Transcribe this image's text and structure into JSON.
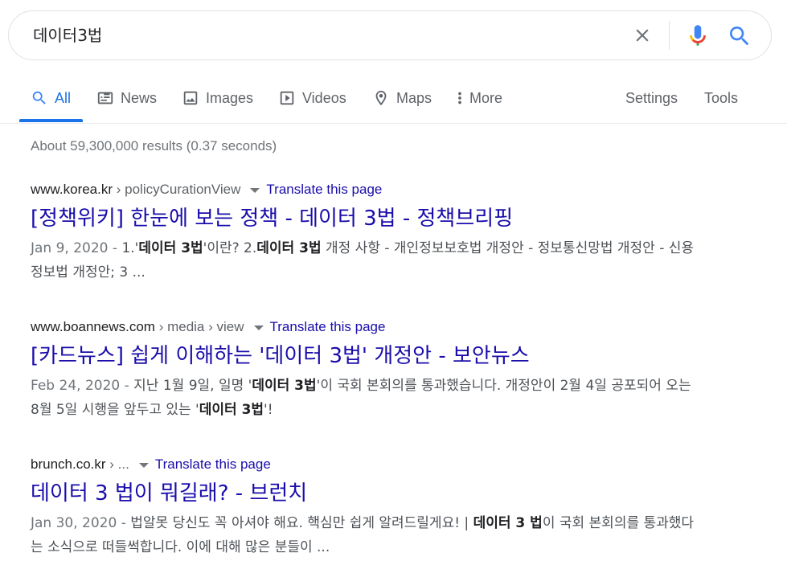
{
  "search": {
    "query": "데이터3법"
  },
  "tabs": [
    {
      "label": "All",
      "icon": "search-icon"
    },
    {
      "label": "News",
      "icon": "news-icon"
    },
    {
      "label": "Images",
      "icon": "image-icon"
    },
    {
      "label": "Videos",
      "icon": "play-icon"
    },
    {
      "label": "Maps",
      "icon": "map-pin-icon"
    },
    {
      "label": "More",
      "icon": "more-vert-icon"
    }
  ],
  "tools": {
    "settings": "Settings",
    "tools": "Tools"
  },
  "stats": "About 59,300,000 results (0.37 seconds)",
  "colors": {
    "link": "#1a0dab",
    "accent": "#1a73e8",
    "snippet": "#4d5156"
  },
  "results": [
    {
      "domain": "www.korea.kr",
      "path": " › policyCurationView",
      "translate": "Translate this page",
      "title": "[정책위키] 한눈에 보는 정책 - 데이터 3법 - 정책브리핑",
      "date": "Jan 9, 2020 - ",
      "snippet_parts": [
        "1.'",
        "데이터 3법",
        "'이란? 2.",
        "데이터 3법",
        " 개정 사항 - 개인정보보호법 개정안 - 정보통신망법 개정안 - 신용정보법 개정안; 3 ..."
      ]
    },
    {
      "domain": "www.boannews.com",
      "path": " › media › view",
      "translate": "Translate this page",
      "title": "[카드뉴스] 쉽게 이해하는 '데이터 3법' 개정안 - 보안뉴스",
      "date": "Feb 24, 2020 - ",
      "snippet_parts": [
        "지난 1월 9일, 일명 '",
        "데이터 3법",
        "'이 국회 본회의를 통과했습니다. 개정안이 2월 4일 공포되어 오는 8월 5일 시행을 앞두고 있는 '",
        "데이터 3법",
        "'!"
      ]
    },
    {
      "domain": "brunch.co.kr",
      "path": " › ...",
      "translate": "Translate this page",
      "title": "데이터 3 법이 뭐길래? - 브런치",
      "date": "Jan 30, 2020 - ",
      "snippet_parts": [
        "법알못 당신도 꼭 아셔야 해요. 핵심만 쉽게 알려드릴게요! | ",
        "데이터 3 법",
        "이 국회 본회의를 통과했다는 소식으로 떠들썩합니다. 이에 대해 많은 분들이 ..."
      ]
    }
  ]
}
